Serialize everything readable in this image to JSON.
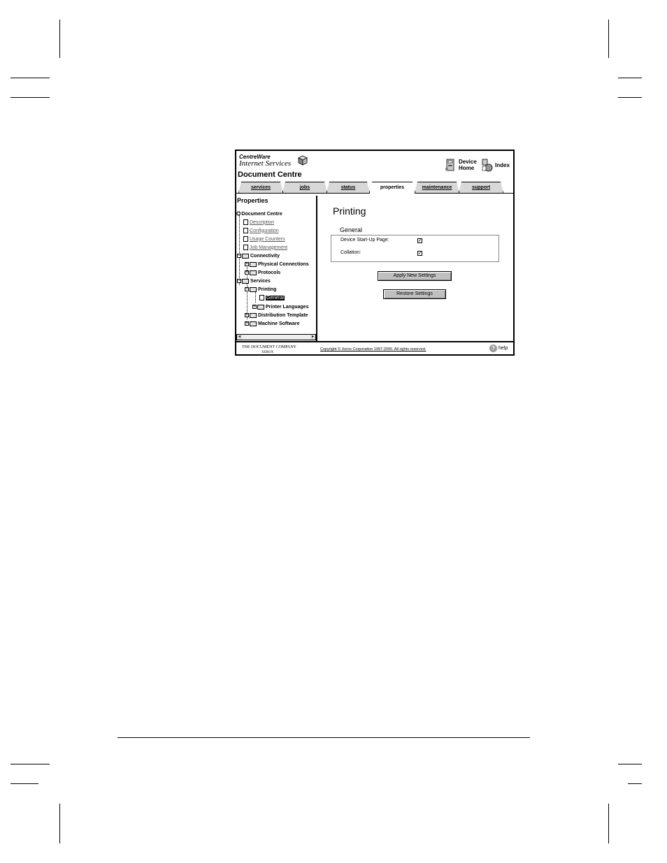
{
  "header": {
    "logo_line1": "CentreWare",
    "logo_line2": "Internet Services",
    "doc_title": "Document Centre",
    "device_home_label": "Device Home",
    "index_label": "Index"
  },
  "tabs": [
    {
      "label": "services",
      "active": false
    },
    {
      "label": "jobs",
      "active": false
    },
    {
      "label": "status",
      "active": false
    },
    {
      "label": "properties",
      "active": true
    },
    {
      "label": "maintenance",
      "active": false
    },
    {
      "label": "support",
      "active": false
    }
  ],
  "left": {
    "title": "Properties",
    "tree": {
      "root": "Document Centre",
      "description": "Description",
      "configuration": "Configuration",
      "usage_counters": "Usage Counters",
      "job_management": "Job Management",
      "connectivity": "Connectivity",
      "physical_connections": "Physical Connections",
      "protocols": "Protocols",
      "services": "Services",
      "printing": "Printing",
      "general": "General",
      "printer_languages": "Printer Languages",
      "distribution_templates": "Distribution Template",
      "machine_software": "Machine Software"
    }
  },
  "main": {
    "heading": "Printing",
    "section": "General",
    "settings": [
      {
        "label": "Device Start-Up Page:",
        "checked": true
      },
      {
        "label": "Collation:",
        "checked": true
      }
    ],
    "apply_label": "Apply New Settings",
    "restore_label": "Restore Settings"
  },
  "footer": {
    "company": "THE DOCUMENT COMPANY",
    "brand": "XEROX",
    "copyright": "Copyright © Xerox Corporation 1997-2000. All rights reserved.",
    "help_label": "help"
  }
}
